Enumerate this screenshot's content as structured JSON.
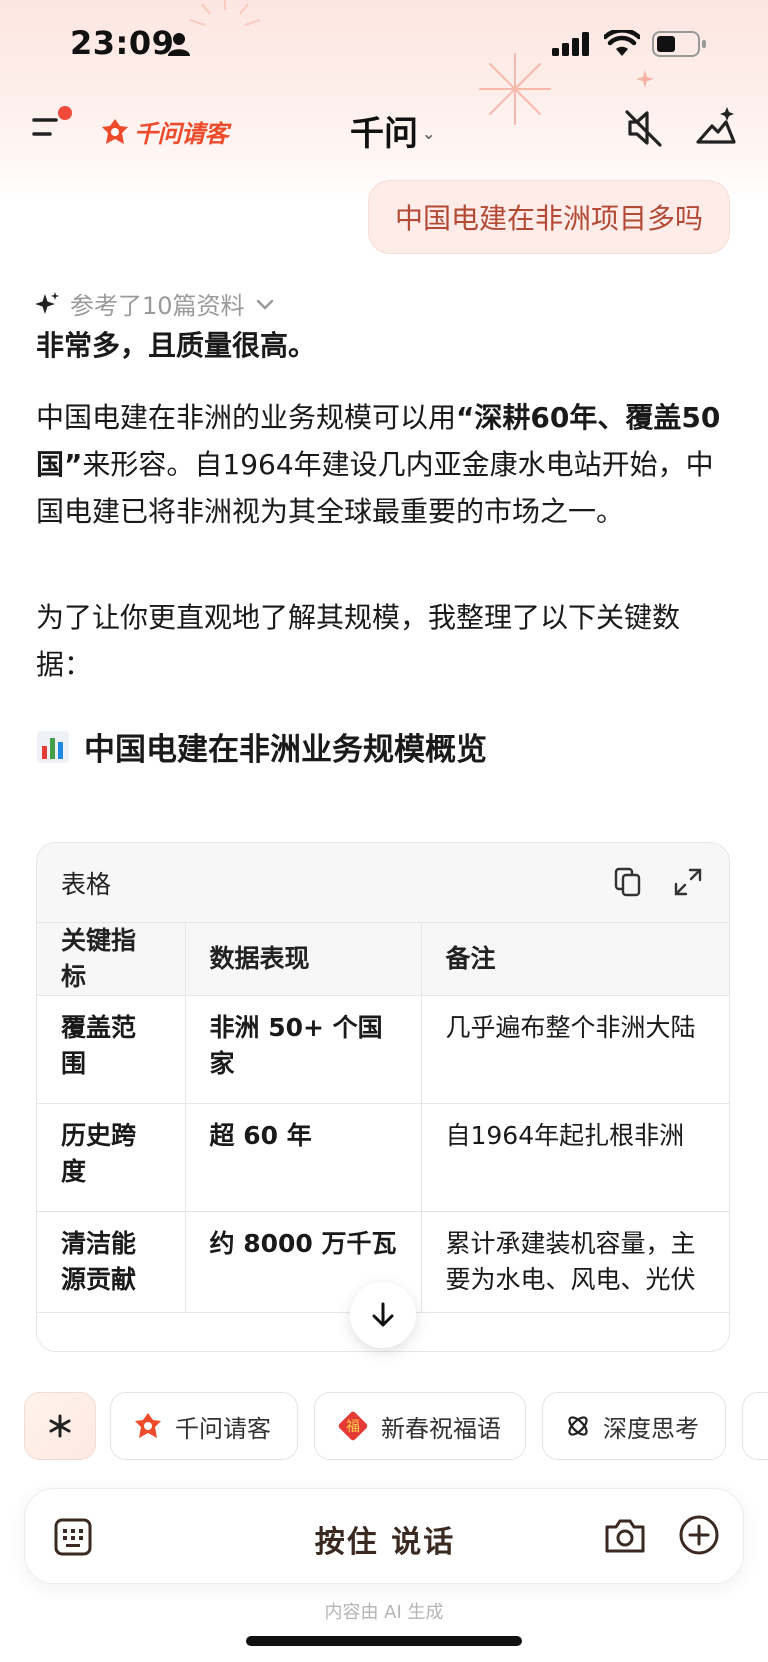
{
  "status_bar": {
    "time": "23:09"
  },
  "nav": {
    "brand": "千问请客",
    "title": "千问",
    "title_caret": "⌄"
  },
  "user_message": "中国电建在非洲项目多吗",
  "references_label": "参考了10篇资料",
  "answer": {
    "lead": "非常多，且质量很高。",
    "p1": {
      "t1": "中国电建在非洲的业务规模可以用",
      "b1": "“深耕60年、覆盖50国”",
      "t2": "来形容。自1964年建设几内亚金康水电站开始，中国电建已将非洲视为其全球最重要的市场之一。"
    },
    "p2": "为了让你更直观地了解其规模，我整理了以下关键数据：",
    "section_title": "中国电建在非洲业务规模概览"
  },
  "table": {
    "label": "表格",
    "headers": [
      "关键指标",
      "数据表现",
      "备注"
    ],
    "rows": [
      [
        "覆盖范围",
        "非洲 50+ 个国家",
        "几乎遍布整个非洲大陆"
      ],
      [
        "历史跨度",
        "超 60 年",
        "自1964年起扎根非洲"
      ],
      [
        "清洁能源贡献",
        "约 8000 万千瓦",
        "累计承建装机容量，主要为水电、风电、光伏"
      ]
    ]
  },
  "chips": {
    "qwen": "千问请客",
    "spring": "新春祝福语",
    "deep": "深度思考"
  },
  "input": {
    "hold_to_talk": "按住 说话"
  },
  "disclaimer": "内容由 AI 生成",
  "colors": {
    "brand": "#ee4b2b",
    "bubble_bg": "#fdece7",
    "bubble_text": "#b34a36"
  }
}
